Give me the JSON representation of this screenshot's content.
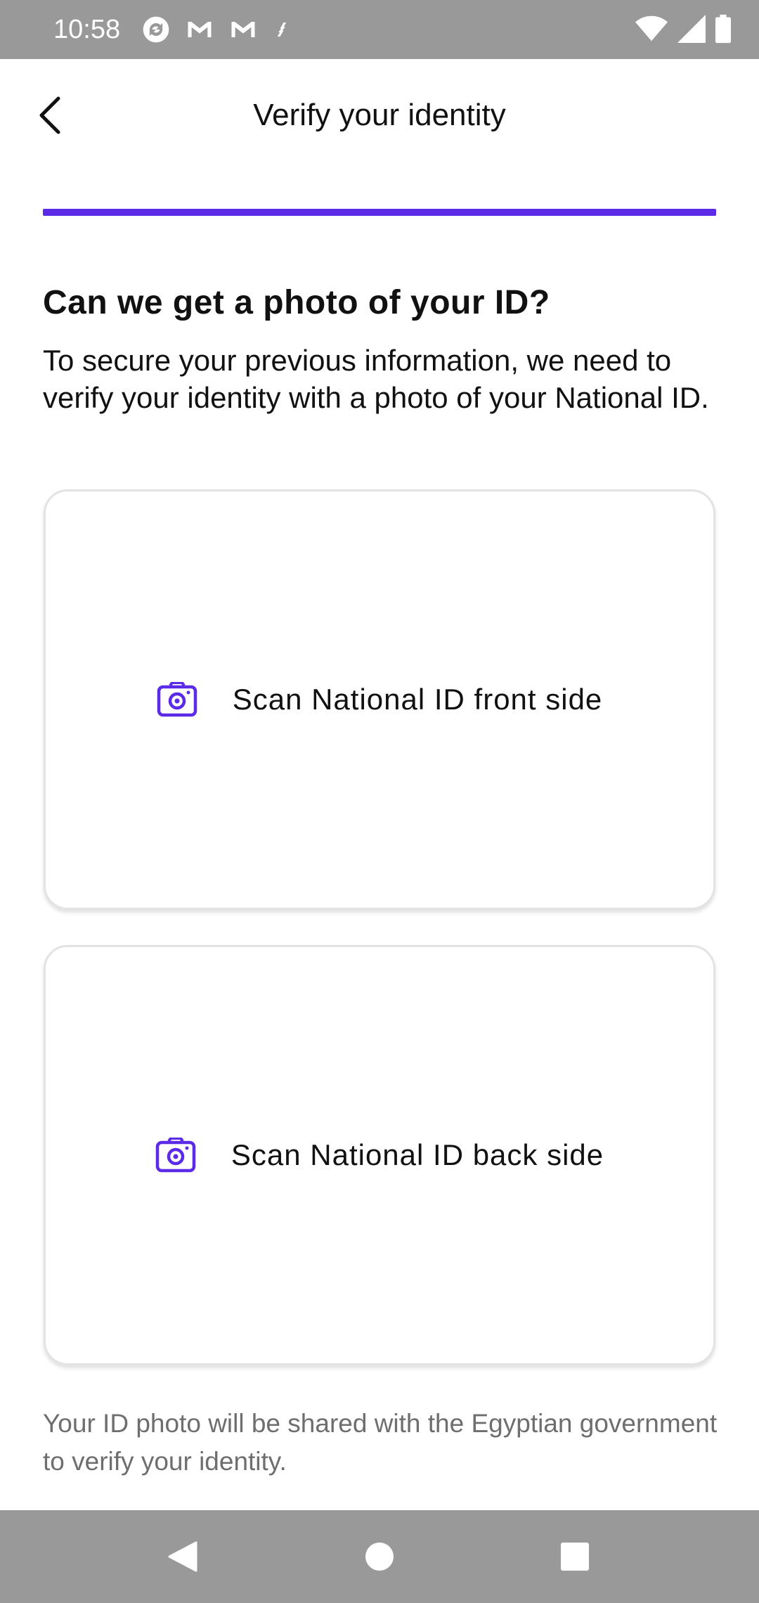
{
  "status_bar": {
    "time": "10:58",
    "left_icons": [
      "sync-icon",
      "gmail-icon",
      "gmail-icon",
      "transfer-icon"
    ],
    "right_icons": [
      "wifi-icon",
      "cellular-signal-icon",
      "battery-icon"
    ]
  },
  "app_bar": {
    "title": "Verify your identity",
    "back_icon": "chevron-left-icon"
  },
  "progress": {
    "value": 1.0,
    "color": "#5b2be8"
  },
  "content": {
    "heading": "Can we get a photo of your ID?",
    "description": "To secure your previous information, we need to verify your identity with a photo of your National ID.",
    "cards": [
      {
        "label": "Scan National ID front side",
        "icon": "camera-icon"
      },
      {
        "label": "Scan National ID back side",
        "icon": "camera-icon"
      }
    ],
    "disclaimer": "Your ID photo will be shared with the Egyptian government to verify your identity."
  },
  "nav_bar": {
    "buttons": [
      "back-triangle-icon",
      "home-circle-icon",
      "recents-square-icon"
    ]
  },
  "colors": {
    "accent": "#5b2be8",
    "system_bars": "#999999",
    "text_primary": "#111111",
    "text_secondary": "#6e6e6e"
  }
}
